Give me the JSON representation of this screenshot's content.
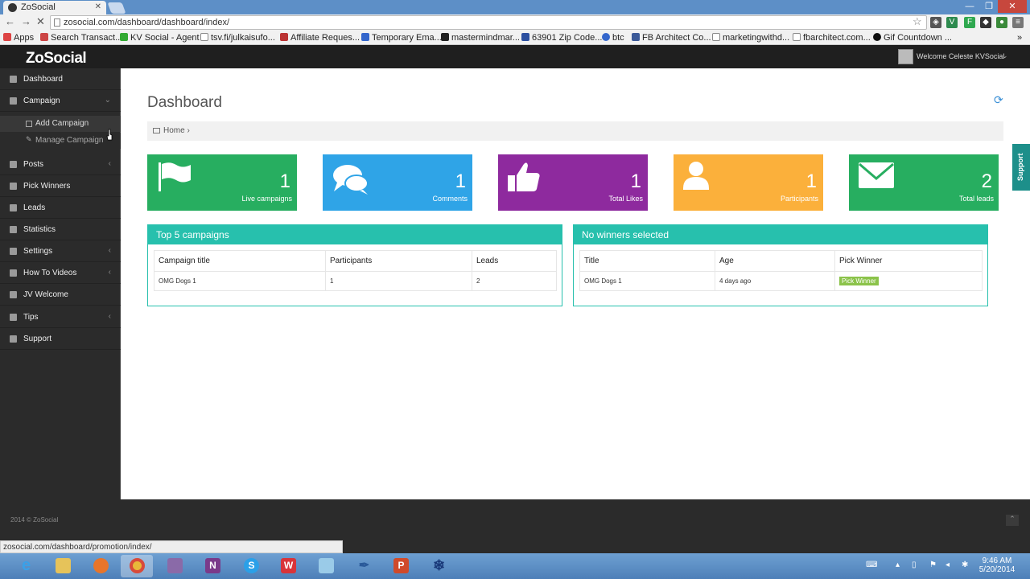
{
  "browser": {
    "tab_title": "ZoSocial",
    "url": "zosocial.com/dashboard/dashboard/index/",
    "status_url": "zosocial.com/dashboard/promotion/index/",
    "bookmarks": [
      {
        "label": "Apps",
        "color": "#d44"
      },
      {
        "label": "Search Transact...",
        "color": "#c44"
      },
      {
        "label": "KV Social - Agent",
        "color": "#3a3"
      },
      {
        "label": "tsv.fi/julkaisufo...",
        "color": "#888"
      },
      {
        "label": "Affiliate Reques...",
        "color": "#b33"
      },
      {
        "label": "Temporary Ema...",
        "color": "#36c"
      },
      {
        "label": "mastermindmar...",
        "color": "#222"
      },
      {
        "label": "63901 Zip Code...",
        "color": "#2b4fa0"
      },
      {
        "label": "btc",
        "color": "#36c"
      },
      {
        "label": "FB Architect Co...",
        "color": "#3b5998"
      },
      {
        "label": "marketingwithd...",
        "color": "#888"
      },
      {
        "label": "fbarchitect.com...",
        "color": "#888"
      },
      {
        "label": "Gif Countdown ...",
        "color": "#111"
      }
    ]
  },
  "header": {
    "logo": "ZoSocial",
    "welcome": "Welcome Celeste KVSocial"
  },
  "sidebar": {
    "items": [
      {
        "label": "Dashboard"
      },
      {
        "label": "Campaign"
      },
      {
        "label": "Posts"
      },
      {
        "label": "Pick Winners"
      },
      {
        "label": "Leads"
      },
      {
        "label": "Statistics"
      },
      {
        "label": "Settings"
      },
      {
        "label": "How To Videos"
      },
      {
        "label": "JV Welcome"
      },
      {
        "label": "Tips"
      },
      {
        "label": "Support"
      }
    ],
    "sub_items": [
      {
        "label": "Add Campaign"
      },
      {
        "label": "Manage Campaign"
      }
    ]
  },
  "main": {
    "title": "Dashboard",
    "breadcrumb": "Home",
    "support_tab": "Support",
    "stats": [
      {
        "value": "1",
        "label": "Live campaigns",
        "color": "#27ae60",
        "icon": "flag-icon"
      },
      {
        "value": "1",
        "label": "Comments",
        "color": "#2fa4e7",
        "icon": "comments-icon"
      },
      {
        "value": "1",
        "label": "Total Likes",
        "color": "#8e2a9e",
        "icon": "thumbs-up-icon"
      },
      {
        "value": "1",
        "label": "Participants",
        "color": "#fbb03b",
        "icon": "user-icon"
      },
      {
        "value": "2",
        "label": "Total leads",
        "color": "#27ae60",
        "icon": "envelope-icon"
      }
    ],
    "top_campaigns": {
      "title": "Top 5 campaigns",
      "columns": [
        "Campaign title",
        "Participants",
        "Leads"
      ],
      "rows": [
        [
          "OMG Dogs 1",
          "1",
          "2"
        ]
      ]
    },
    "winners": {
      "title": "No winners selected",
      "columns": [
        "Title",
        "Age",
        "Pick Winner"
      ],
      "rows": [
        [
          "OMG Dogs 1",
          "4 days ago",
          "Pick Winner"
        ]
      ]
    }
  },
  "footer": {
    "copyright": "2014 © ZoSocial"
  },
  "taskbar": {
    "time": "9:46 AM",
    "date": "5/20/2014"
  }
}
